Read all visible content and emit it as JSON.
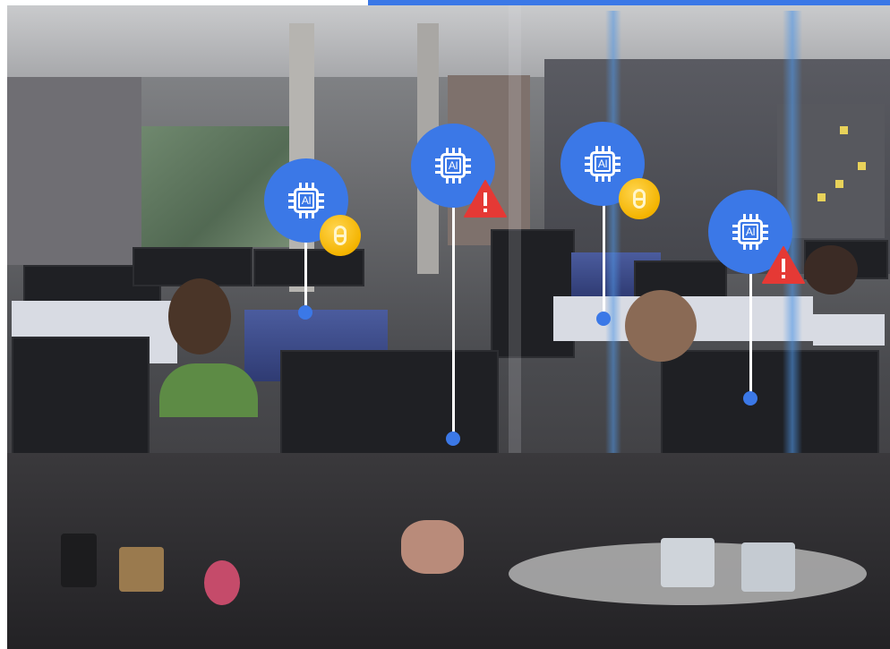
{
  "image": {
    "accent_color": "#3b78e7",
    "warning_color": "#e53935",
    "cost_color": "#f4b400"
  },
  "markers": [
    {
      "icon": "ai-chip-icon",
      "label": "AI",
      "status_icon": "coin-icon"
    },
    {
      "icon": "ai-chip-icon",
      "label": "AI",
      "status_icon": "warning-icon"
    },
    {
      "icon": "ai-chip-icon",
      "label": "AI",
      "status_icon": "coin-icon"
    },
    {
      "icon": "ai-chip-icon",
      "label": "AI",
      "status_icon": "warning-icon"
    }
  ]
}
